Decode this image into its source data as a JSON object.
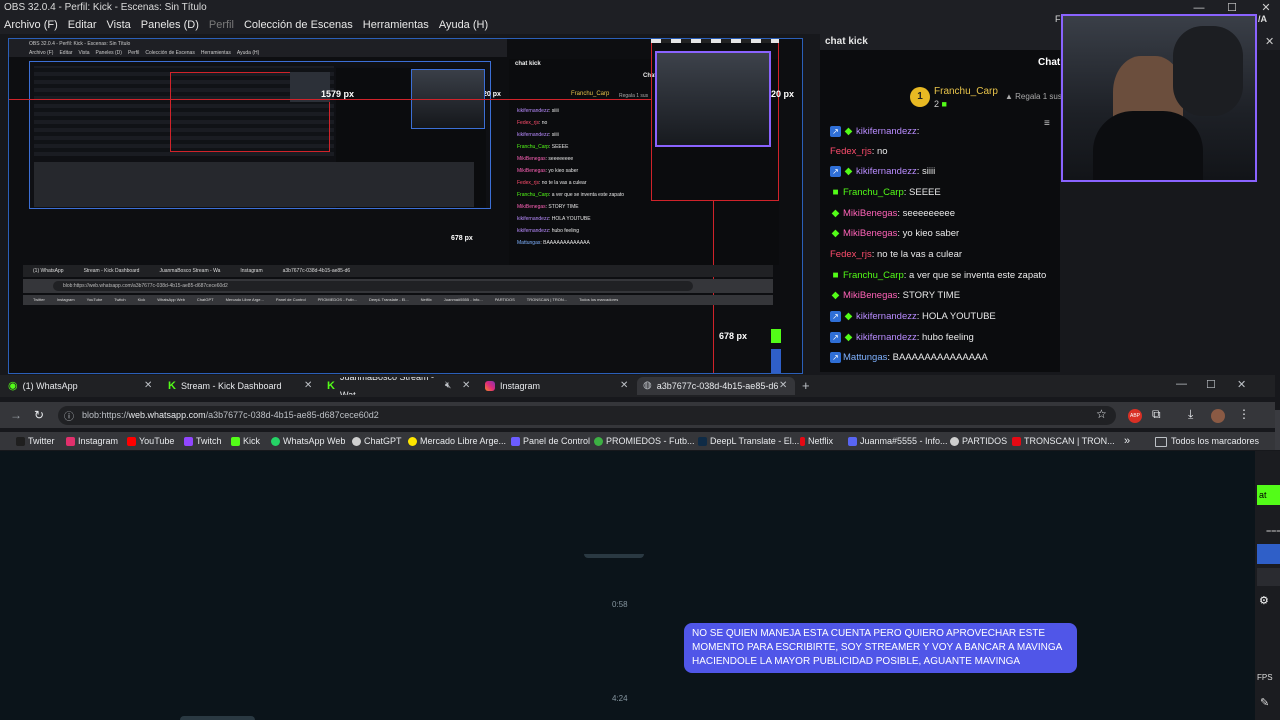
{
  "obs": {
    "title": "OBS 32.0.4 - Perfil: Kick - Escenas: Sin Título",
    "menu": [
      "Archivo (F)",
      "Editar",
      "Vista",
      "Paneles (D)",
      "Perfil",
      "Colección de Escenas",
      "Herramientas",
      "Ayuda (H)"
    ],
    "menu_dim_index": 4,
    "window_controls": [
      "—",
      "☐",
      "✕"
    ]
  },
  "preview": {
    "nested_title": "OBS 32.0.4 - Perfil: Kick - Escenas: Sin Título",
    "nested_menu": [
      "Archivo (F)",
      "Editar",
      "Vista",
      "Paneles (D)",
      "Perfil",
      "Colección de Escenas",
      "Herramientas",
      "Ayuda (H)"
    ],
    "px_top_left": "1579 px",
    "px_top_right": "20 px",
    "px_bottom": "678 px",
    "nested_px_top": "1579 px",
    "nested_px_right": "20 px",
    "nested_px_bottom": "678 px",
    "nested_chat_title": "chat kick",
    "nested_chat_header": "Chat",
    "nested_pinned_user": "Franchu_Carp",
    "nested_pinned_gift": "Regala 1 sus",
    "nested_url": "blob:https://web.whatsapp.com/a3b7677c-038d-4b15-ae85-d687cece60d2",
    "nested_tabs": [
      "(1) WhatsApp",
      "Stream - Kick Dashboard",
      "JuanmaBosco Stream - Wa",
      "Instagram",
      "a3b7677c-038d-4b15-ae85-d6"
    ],
    "nested_bookmarks": [
      "Twitter",
      "Instagram",
      "YouTube",
      "Twitch",
      "Kick",
      "WhatsApp Web",
      "ChatGPT",
      "Mercado Libre Arge...",
      "Panel de Control",
      "PROMIEDOS - Futb...",
      "DeepL Translate - El...",
      "Netflix",
      "Juanma#5555 - Info...",
      "PARTIDOS",
      "TRONSCAN | TRON...",
      "Todos los marcadores"
    ],
    "nested_chat": [
      {
        "user": "kikifernandezz",
        "text": "siiii"
      },
      {
        "user": "Fedex_rjs",
        "text": "no"
      },
      {
        "user": "kikifernandezz",
        "text": "siiii"
      },
      {
        "user": "Franchu_Carp",
        "text": "SEEEE"
      },
      {
        "user": "MikiBenegas",
        "text": "seeeeeeee"
      },
      {
        "user": "MikiBenegas",
        "text": "yo kieo saber"
      },
      {
        "user": "Fedex_rjs",
        "text": "no te la vas a culear"
      },
      {
        "user": "Franchu_Carp",
        "text": "a ver que se inventa este zapato"
      },
      {
        "user": "MikiBenegas",
        "text": "STORY TIME"
      },
      {
        "user": "kikifernandezz",
        "text": "HOLA YOUTUBE"
      },
      {
        "user": "kikifernandezz",
        "text": "hubo feeling"
      },
      {
        "user": "Mattungas",
        "text": "BAAAAAAAAAAAAA"
      }
    ]
  },
  "chat": {
    "dock_title": "chat kick",
    "header": "Chat",
    "pinned_user": "Franchu_Carp",
    "pinned_count": "2",
    "pinned_rank": "1",
    "pinned_gift": "Regala 1 sus",
    "messages": [
      {
        "user": "kikifernandezz",
        "text": "",
        "badge": "blue",
        "color": "purple"
      },
      {
        "user": "Fedex_rjs",
        "text": "no",
        "badge": "none",
        "color": "red"
      },
      {
        "user": "kikifernandezz",
        "text": "siiii",
        "badge": "blue",
        "color": "purple"
      },
      {
        "user": "Franchu_Carp",
        "text": "SEEEE",
        "badge": "green",
        "color": "green"
      },
      {
        "user": "MikiBenegas",
        "text": "seeeeeeeee",
        "badge": "green",
        "color": "pink"
      },
      {
        "user": "MikiBenegas",
        "text": "yo kieo saber",
        "badge": "green",
        "color": "pink"
      },
      {
        "user": "Fedex_rjs",
        "text": "no te la vas a culear",
        "badge": "none",
        "color": "red"
      },
      {
        "user": "Franchu_Carp",
        "text": "a ver que se inventa este zapato",
        "badge": "green",
        "color": "green"
      },
      {
        "user": "MikiBenegas",
        "text": "STORY TIME",
        "badge": "green",
        "color": "pink"
      },
      {
        "user": "kikifernandezz",
        "text": "HOLA YOUTUBE",
        "badge": "blue",
        "color": "purple"
      },
      {
        "user": "kikifernandezz",
        "text": "hubo feeling",
        "badge": "blue",
        "color": "purple"
      },
      {
        "user": "Mattungas",
        "text": "BAAAAAAAAAAAAAA",
        "badge": "blue",
        "color": "blue"
      }
    ],
    "top_right_fragment": "F",
    "top_right_fragment2": "/A"
  },
  "browser": {
    "tabs": [
      {
        "label": "(1) WhatsApp",
        "icon": "whatsapp-icon"
      },
      {
        "label": "Stream - Kick Dashboard",
        "icon": "kick-icon"
      },
      {
        "label": "JuanmaBosco Stream - Wat",
        "icon": "kick-icon"
      },
      {
        "label": "Instagram",
        "icon": "instagram-icon"
      },
      {
        "label": "a3b7677c-038d-4b15-ae85-d6",
        "icon": "globe-icon",
        "active": true
      }
    ],
    "new_tab": "+",
    "window_controls": [
      "—",
      "☐",
      "✕"
    ],
    "url_prefix": "blob:https://",
    "url_host": "web.whatsapp.com",
    "url_rest": "/a3b7677c-038d-4b15-ae85-d687cece60d2",
    "bookmarks": [
      {
        "label": "Twitter",
        "color": "#1f1f1f"
      },
      {
        "label": "Instagram",
        "color": "#e1306c"
      },
      {
        "label": "YouTube",
        "color": "#ff0000"
      },
      {
        "label": "Twitch",
        "color": "#9146ff"
      },
      {
        "label": "Kick",
        "color": "#53fc18"
      },
      {
        "label": "WhatsApp Web",
        "color": "#25d366"
      },
      {
        "label": "ChatGPT",
        "color": "#cfcfcf"
      },
      {
        "label": "Mercado Libre Arge...",
        "color": "#ffe600"
      },
      {
        "label": "Panel de Control",
        "color": "#6b5cff"
      },
      {
        "label": "PROMIEDOS - Futb...",
        "color": "#3cb043"
      },
      {
        "label": "DeepL Translate - El...",
        "color": "#0f2b46"
      },
      {
        "label": "Netflix",
        "color": "#e50914"
      },
      {
        "label": "Juanma#5555 - Info...",
        "color": "#5865f2"
      },
      {
        "label": "PARTIDOS",
        "color": "#cfcfcf"
      },
      {
        "label": "TRONSCAN | TRON...",
        "color": "#e50914"
      }
    ],
    "more_bookmarks": "»",
    "all_bookmarks": "Todos los marcadores"
  },
  "whatsapp": {
    "time1": "0:58",
    "time2": "4:24",
    "message": "NO SE QUIEN MANEJA ESTA CUENTA PERO QUIERO APROVECHAR ESTE MOMENTO PARA ESCRIBIRTE, SOY STREAMER Y VOY A BANCAR A MAVINGA HACIENDOLE LA MAYOR PUBLICIDAD POSIBLE, AGUANTE MAVINGA"
  },
  "right_strip": {
    "green_label": "at",
    "fps_label": "FPS"
  },
  "colors": {
    "kick_green": "#53fc18",
    "selection_red": "#d0232a",
    "obs_blue": "#3c6fd6",
    "bubble": "#5056e8",
    "webcam_border": "#8a63ff"
  }
}
